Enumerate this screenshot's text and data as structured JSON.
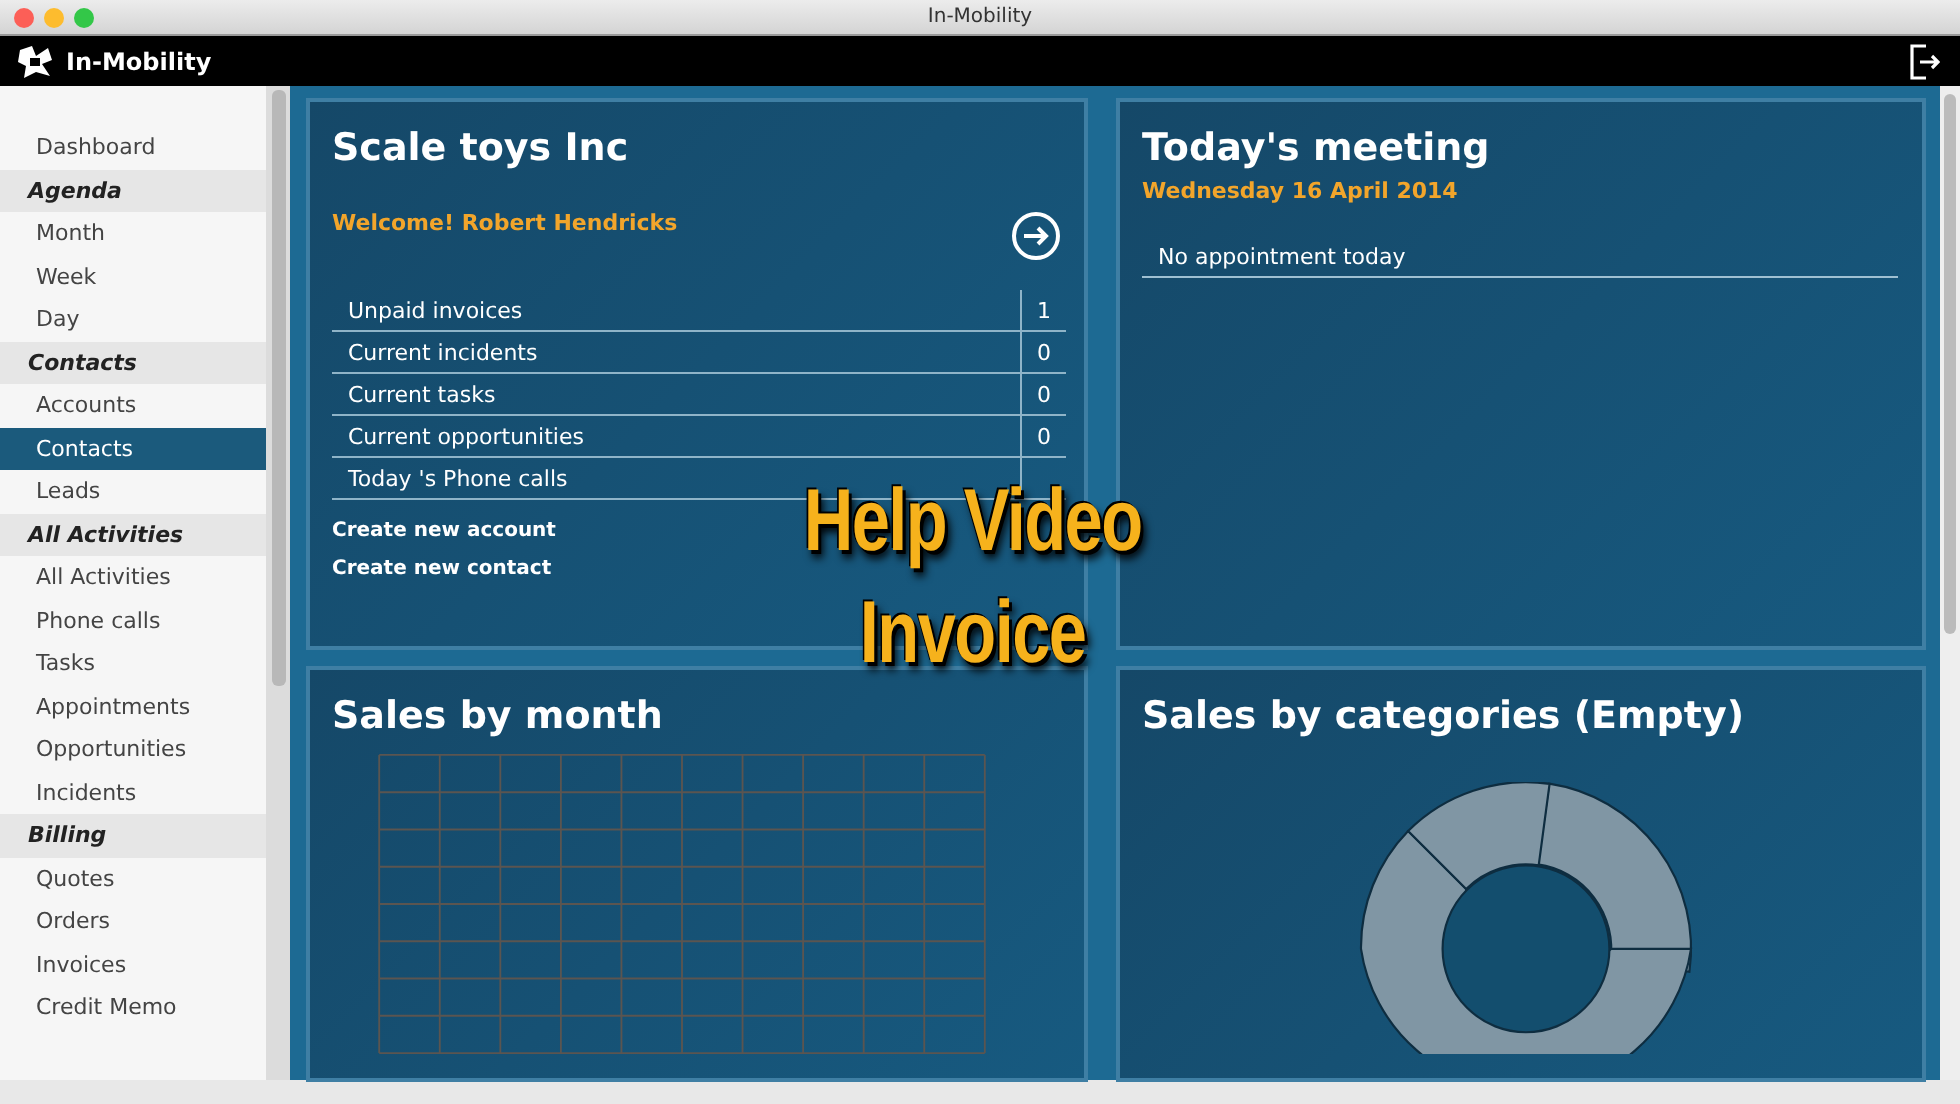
{
  "window": {
    "title": "In-Mobility"
  },
  "app_bar": {
    "logo_text": "In-Mobility"
  },
  "sidebar": {
    "items": [
      {
        "kind": "item",
        "label": "Dashboard",
        "selected": false
      },
      {
        "kind": "header",
        "label": "Agenda"
      },
      {
        "kind": "item",
        "label": "Month",
        "selected": false
      },
      {
        "kind": "item",
        "label": "Week",
        "selected": false
      },
      {
        "kind": "item",
        "label": "Day",
        "selected": false
      },
      {
        "kind": "header",
        "label": "Contacts"
      },
      {
        "kind": "item",
        "label": "Accounts",
        "selected": false
      },
      {
        "kind": "item",
        "label": "Contacts",
        "selected": true
      },
      {
        "kind": "item",
        "label": "Leads",
        "selected": false
      },
      {
        "kind": "header",
        "label": "All Activities"
      },
      {
        "kind": "item",
        "label": "All Activities",
        "selected": false
      },
      {
        "kind": "item",
        "label": "Phone calls",
        "selected": false
      },
      {
        "kind": "item",
        "label": "Tasks",
        "selected": false
      },
      {
        "kind": "item",
        "label": "Appointments",
        "selected": false
      },
      {
        "kind": "item",
        "label": "Opportunities",
        "selected": false
      },
      {
        "kind": "item",
        "label": "Incidents",
        "selected": false
      },
      {
        "kind": "header",
        "label": "Billing"
      },
      {
        "kind": "item",
        "label": "Quotes",
        "selected": false
      },
      {
        "kind": "item",
        "label": "Orders",
        "selected": false
      },
      {
        "kind": "item",
        "label": "Invoices",
        "selected": false
      },
      {
        "kind": "item",
        "label": "Credit Memo",
        "selected": false
      }
    ]
  },
  "account_card": {
    "title": "Scale toys Inc",
    "welcome": "Welcome! Robert Hendricks",
    "stats": [
      {
        "label": "Unpaid invoices",
        "count": "1"
      },
      {
        "label": "Current incidents",
        "count": "0"
      },
      {
        "label": "Current tasks",
        "count": "0"
      },
      {
        "label": "Current opportunities",
        "count": "0"
      },
      {
        "label": "Today 's Phone calls"
      }
    ],
    "links": [
      "Create new account",
      "Create new contact"
    ]
  },
  "meeting_card": {
    "title": "Today's meeting",
    "date": "Wednesday 16 April 2014",
    "empty_text": "No appointment today"
  },
  "sales_month_card": {
    "title": "Sales by month"
  },
  "sales_categories_card": {
    "title": "Sales by categories (Empty)"
  },
  "video_caption": [
    "Help Video",
    "Invoice"
  ]
}
